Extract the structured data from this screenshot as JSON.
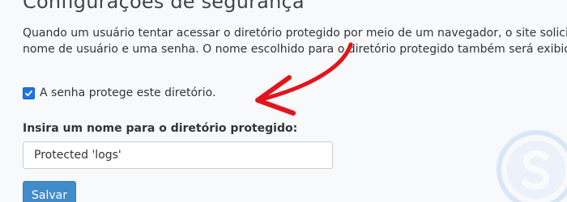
{
  "page": {
    "title": "Configurações de segurança",
    "description_line1": "Quando um usuário tentar acessar o diretório protegido por meio de um navegador, o site solicitará qu",
    "description_line2": "nome de usuário e uma senha. O nome escolhido para o diretório protegido também será exibido."
  },
  "form": {
    "password_protect_label": "A senha protege este diretório.",
    "password_protect_checked": true,
    "name_label": "Insira um nome para o diretório protegido:",
    "name_value": "Protected 'logs'",
    "save_label": "Salvar"
  },
  "annotation": {
    "arrow_color": "#e3151a"
  },
  "colors": {
    "accent": "#428bca",
    "checkbox": "#1a73e8"
  }
}
